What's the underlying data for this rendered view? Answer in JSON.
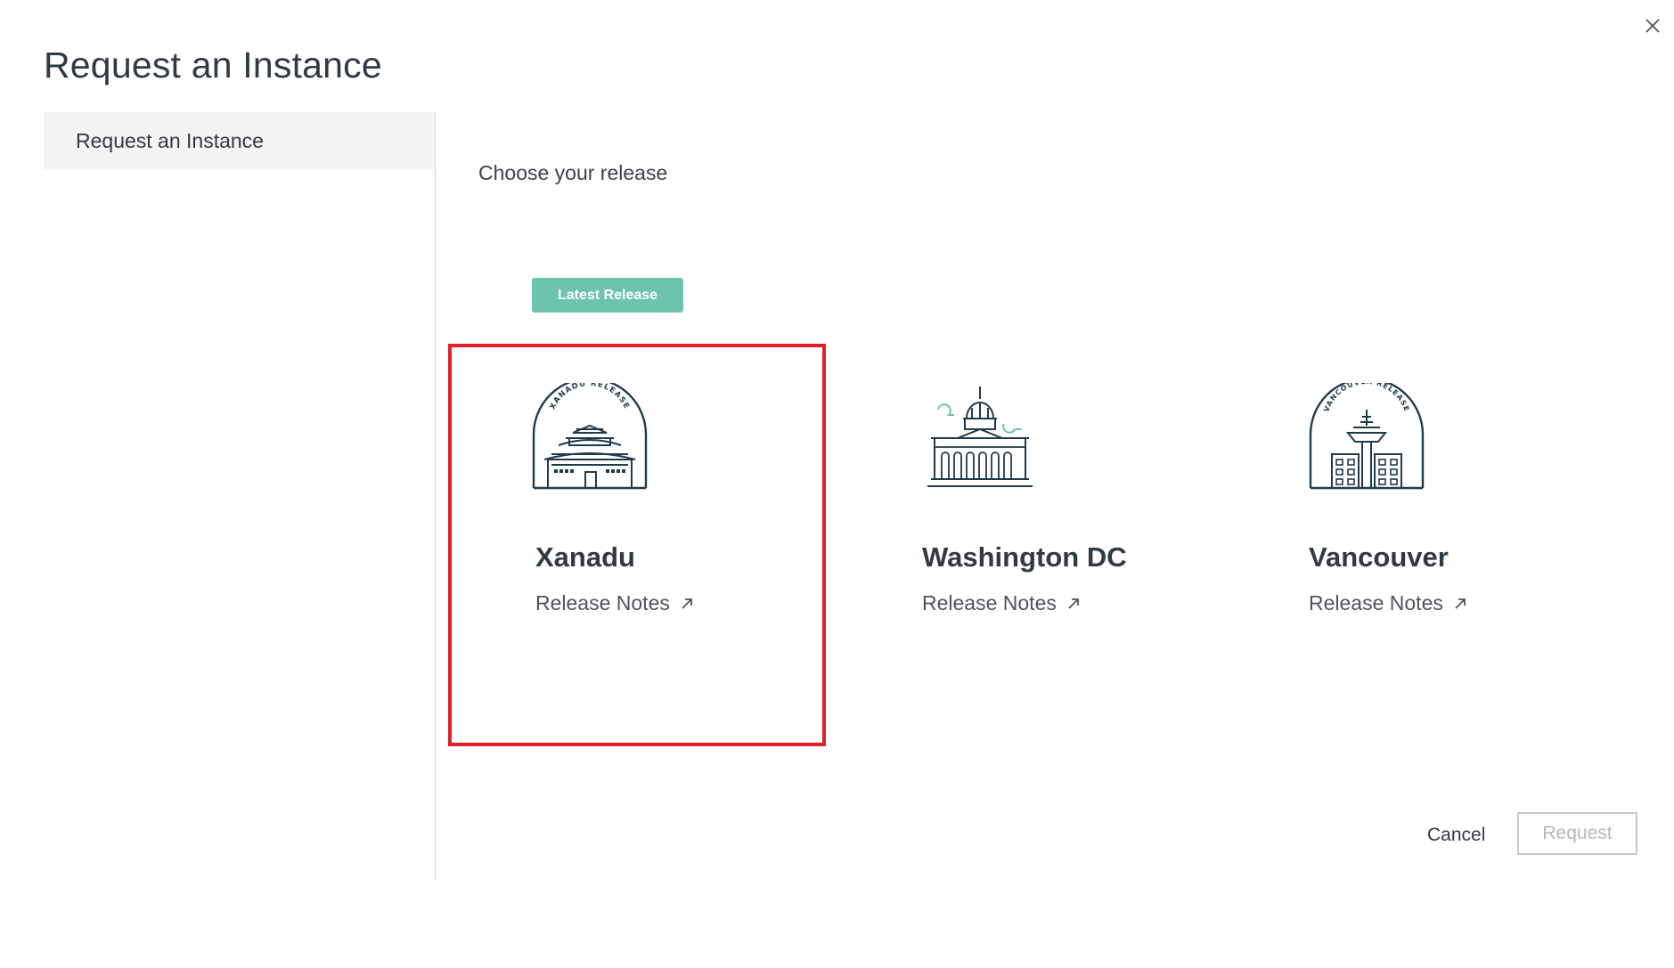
{
  "dialog": {
    "title": "Request an Instance",
    "close_icon": "close-icon"
  },
  "sidebar": {
    "items": [
      {
        "label": "Request an Instance",
        "selected": true
      }
    ]
  },
  "main": {
    "section_title": "Choose your release",
    "latest_badge": "Latest Release",
    "releases": [
      {
        "name": "Xanadu",
        "notes_label": "Release Notes",
        "badge_text": "XANADU RELEASE",
        "icon": "xanadu-temple-icon",
        "selected": true
      },
      {
        "name": "Washington DC",
        "notes_label": "Release Notes",
        "icon": "capitol-building-icon",
        "selected": false
      },
      {
        "name": "Vancouver",
        "notes_label": "Release Notes",
        "badge_text": "VANCOUVER RELEASE",
        "icon": "space-needle-icon",
        "selected": false
      }
    ]
  },
  "footer": {
    "cancel_label": "Cancel",
    "request_label": "Request",
    "request_enabled": false
  },
  "colors": {
    "accent_badge": "#6cc5ab",
    "selection_border": "#e01f26",
    "icon_stroke": "#1f3a4a"
  }
}
